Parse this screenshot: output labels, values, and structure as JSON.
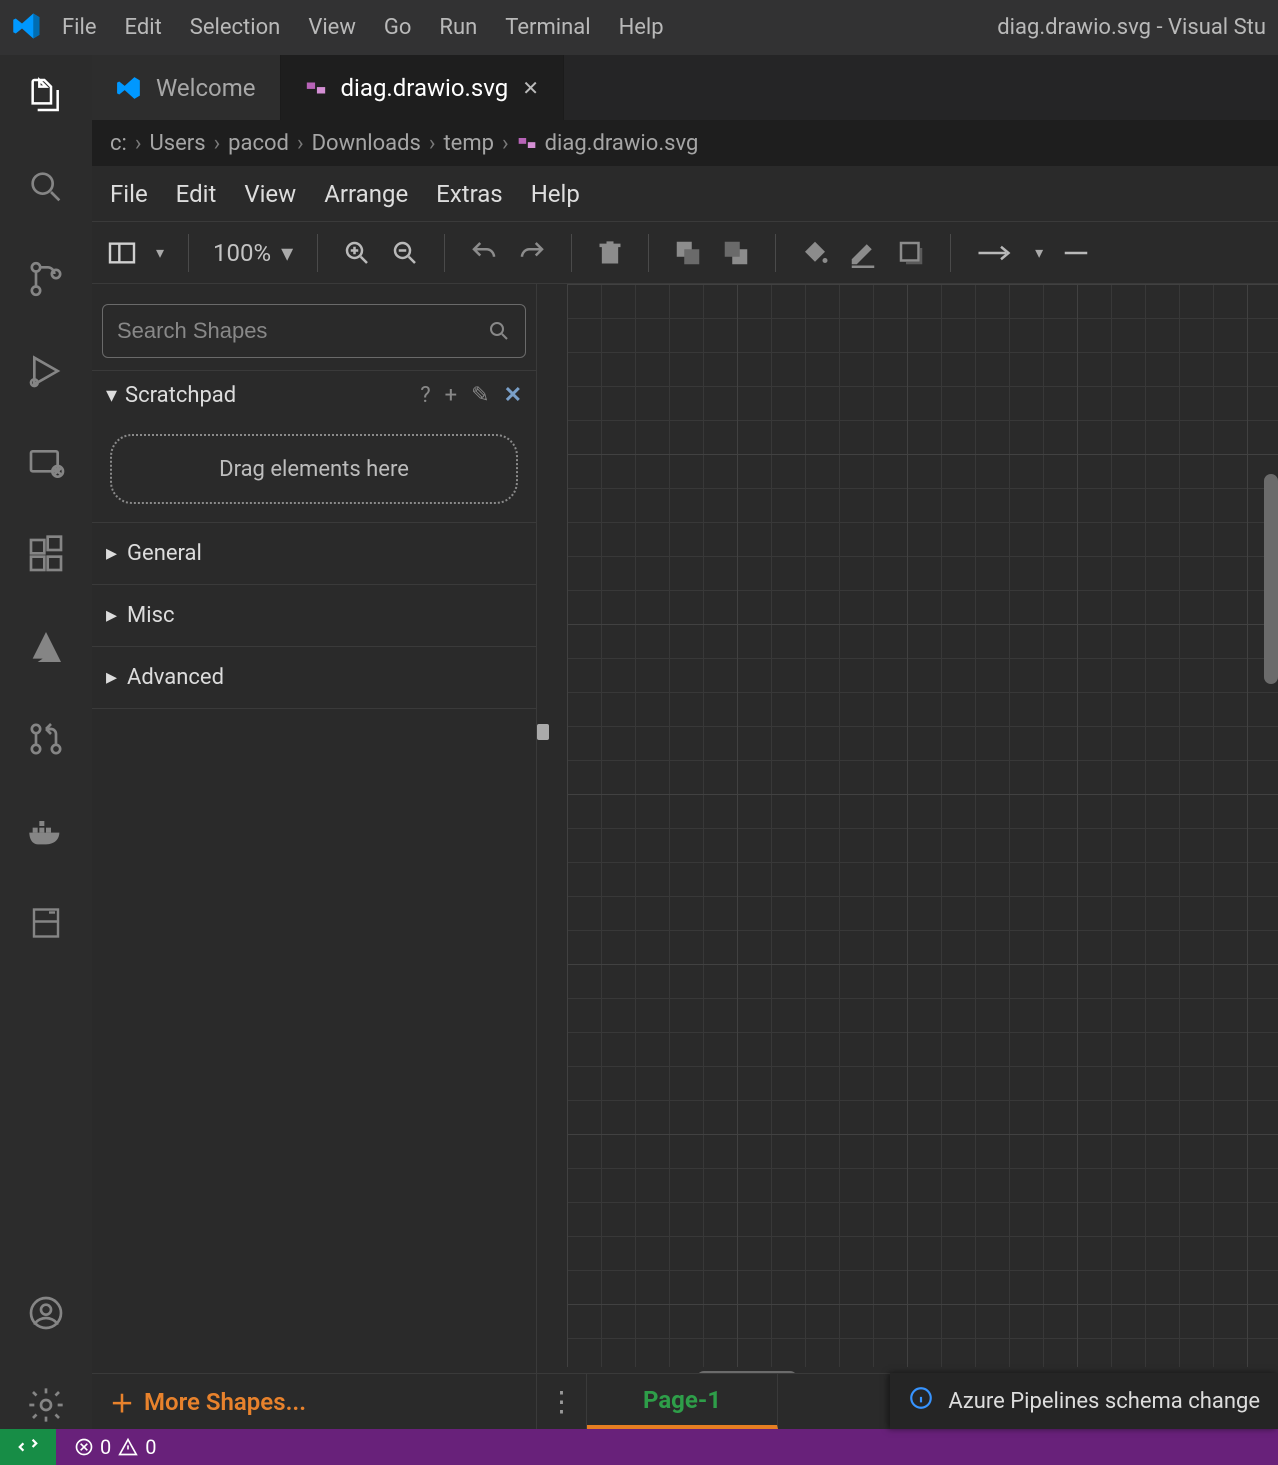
{
  "titlebar": {
    "menus": [
      "File",
      "Edit",
      "Selection",
      "View",
      "Go",
      "Run",
      "Terminal",
      "Help"
    ],
    "title": "diag.drawio.svg - Visual Stu"
  },
  "tabs": [
    {
      "label": "Welcome",
      "active": false
    },
    {
      "label": "diag.drawio.svg",
      "active": true
    }
  ],
  "breadcrumbs": [
    "c:",
    "Users",
    "pacod",
    "Downloads",
    "temp",
    "diag.drawio.svg"
  ],
  "drawio": {
    "menus": [
      "File",
      "Edit",
      "View",
      "Arrange",
      "Extras",
      "Help"
    ],
    "zoom": "100%",
    "search_placeholder": "Search Shapes",
    "scratchpad_label": "Scratchpad",
    "scratchpad_drop": "Drag elements here",
    "groups": [
      "General",
      "Misc",
      "Advanced"
    ],
    "more_shapes": "More Shapes...",
    "page_label": "Page-1"
  },
  "toast": "Azure Pipelines schema change",
  "statusbar": {
    "errors": "0",
    "warnings": "0"
  }
}
